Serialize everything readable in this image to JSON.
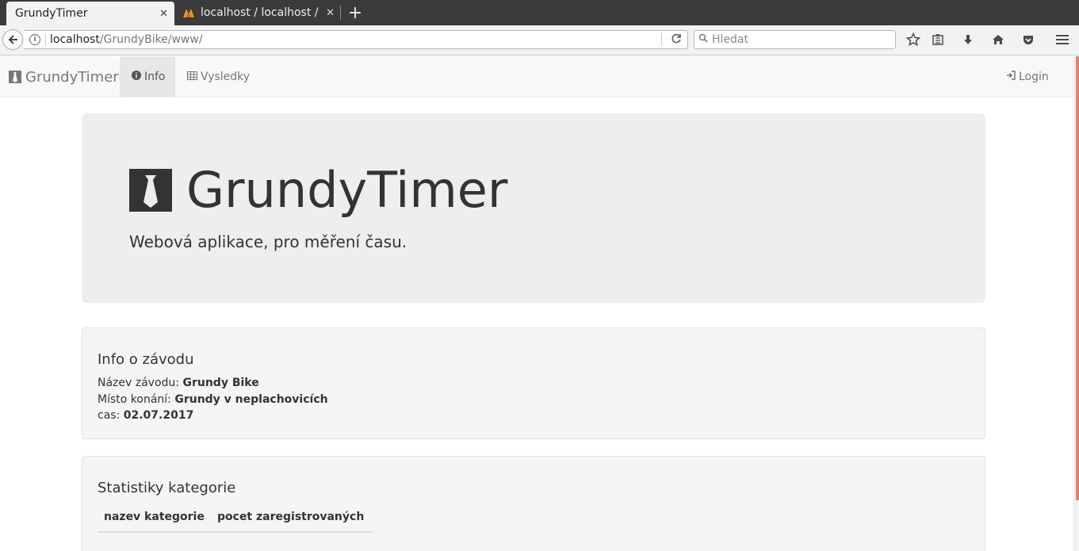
{
  "browser": {
    "tabs": [
      {
        "title": "GrundyTimer",
        "active": true
      },
      {
        "title": "localhost / localhost / ",
        "active": false
      }
    ],
    "new_tab": "+",
    "url_host": "localhost",
    "url_path": "/GrundyBike/www/",
    "search_placeholder": "Hledat"
  },
  "app": {
    "brand": "GrundyTimer",
    "nav": {
      "info": "Info",
      "vysledky": "Vysledky",
      "login": "Login"
    }
  },
  "jumbotron": {
    "title": "GrundyTimer",
    "lead": "Webová aplikace, pro měření času."
  },
  "race_info": {
    "heading": "Info o závodu",
    "name_label": "Název závodu:",
    "name_value": "Grundy Bike",
    "place_label": "Místo konání:",
    "place_value": "Grundy v neplachovicích",
    "time_label": "cas:",
    "time_value": "02.07.2017"
  },
  "stats": {
    "heading": "Statistiky kategorie",
    "columns": [
      "nazev kategorie",
      "pocet zaregistrovaných"
    ]
  },
  "colors": {
    "scroll_thumb": "#e8826a",
    "jumbotron_bg": "#eeeeee",
    "navbar_bg": "#f8f8f8"
  }
}
